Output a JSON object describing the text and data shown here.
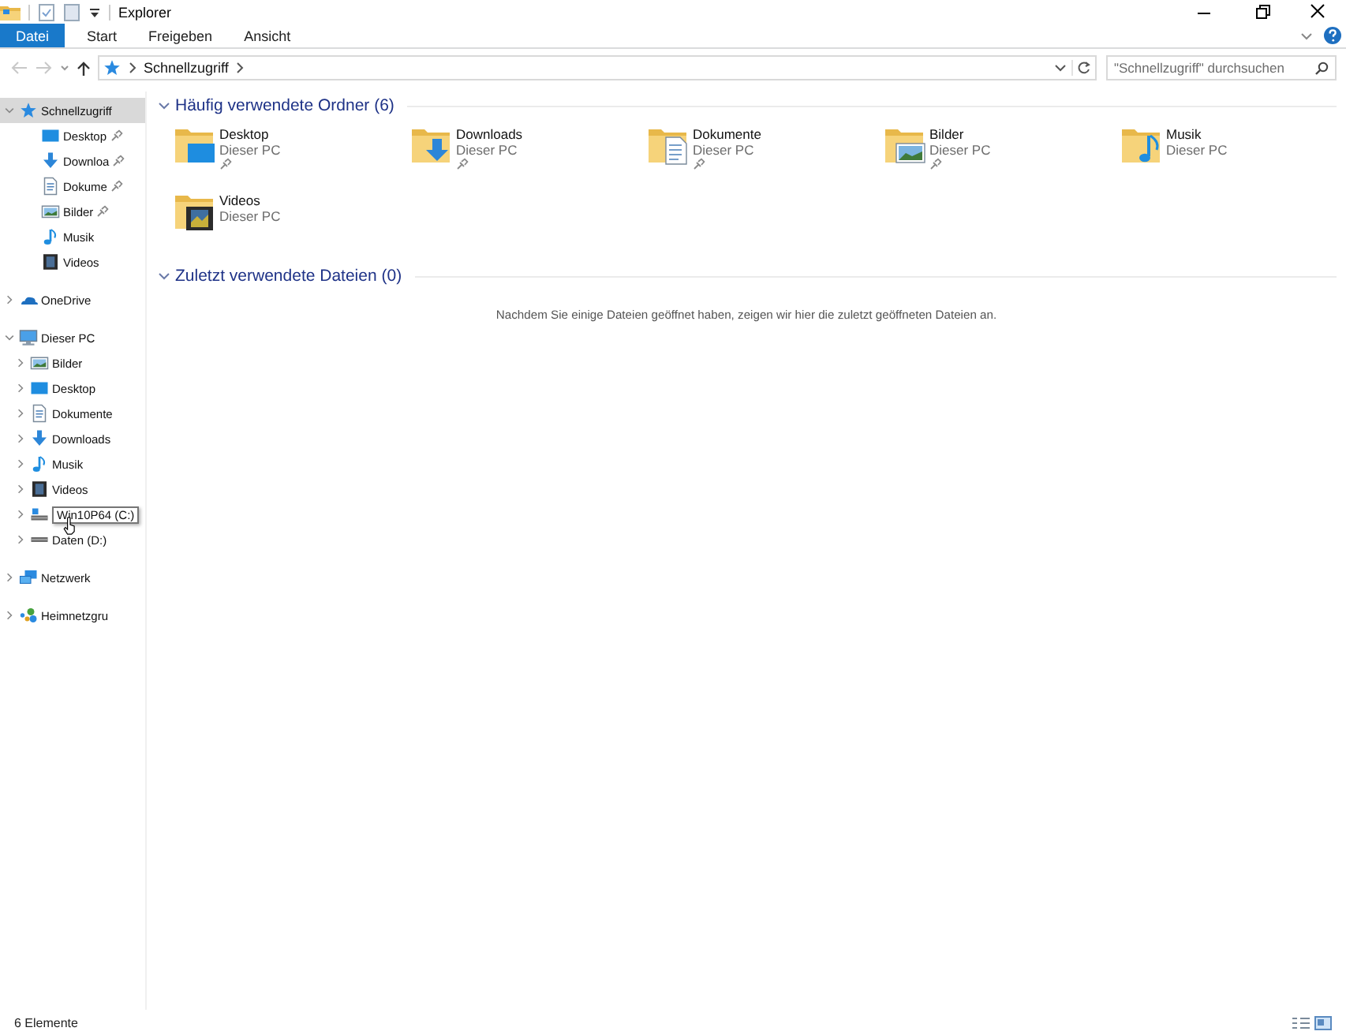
{
  "window": {
    "title": "Explorer"
  },
  "ribbon_tabs": [
    {
      "label": "Datei",
      "kind": "file"
    },
    {
      "label": "Start",
      "kind": "tab"
    },
    {
      "label": "Freigeben",
      "kind": "tab"
    },
    {
      "label": "Ansicht",
      "kind": "tab"
    }
  ],
  "navigation": {
    "back_disabled": true,
    "forward_disabled": true
  },
  "address_bar": {
    "breadcrumb": [
      "Schnellzugriff"
    ]
  },
  "search": {
    "placeholder": "\"Schnellzugriff\" durchsuchen"
  },
  "sidebar": {
    "items": [
      {
        "label": "Schnellzugriff",
        "kind": "star",
        "expanded": true,
        "selected": true,
        "hovered": false,
        "children": [
          {
            "label": "Desktop",
            "kind": "desktop",
            "pinned": true
          },
          {
            "label": "Downloa",
            "kind": "downloads",
            "pinned": true
          },
          {
            "label": "Dokume",
            "kind": "documents",
            "pinned": true
          },
          {
            "label": "Bilder",
            "kind": "pictures",
            "pinned": true
          },
          {
            "label": "Musik",
            "kind": "music",
            "pinned": false
          },
          {
            "label": "Videos",
            "kind": "videos",
            "pinned": false
          }
        ]
      },
      {
        "label": "OneDrive",
        "kind": "cloud",
        "expanded": false,
        "selected": false,
        "hovered": false
      },
      {
        "label": "Dieser PC",
        "kind": "pc",
        "expanded": true,
        "selected": false,
        "hovered": false,
        "children": [
          {
            "label": "Bilder",
            "kind": "pictures",
            "expanded": false,
            "hovered": false
          },
          {
            "label": "Desktop",
            "kind": "desktop",
            "expanded": false,
            "hovered": false
          },
          {
            "label": "Dokumente",
            "kind": "documents",
            "expanded": false,
            "hovered": false
          },
          {
            "label": "Downloads",
            "kind": "downloads",
            "expanded": false,
            "hovered": false
          },
          {
            "label": "Musik",
            "kind": "music",
            "expanded": false,
            "hovered": false
          },
          {
            "label": "Videos",
            "kind": "videos",
            "expanded": false,
            "hovered": false
          },
          {
            "label": "Win10P64 (C:)",
            "kind": "drive-os",
            "expanded": false,
            "hovered": true
          },
          {
            "label": "Daten (D:)",
            "kind": "drive",
            "expanded": false,
            "hovered": false
          }
        ]
      },
      {
        "label": "Netzwerk",
        "kind": "network",
        "expanded": false,
        "selected": false,
        "hovered": false
      },
      {
        "label": "Heimnetzgru",
        "kind": "homegroup",
        "expanded": false,
        "selected": false,
        "hovered": false
      }
    ]
  },
  "sections": [
    {
      "title": "Häufig verwendete Ordner (6)",
      "expanded": true,
      "items": [
        {
          "name": "Desktop",
          "location": "Dieser PC",
          "kind": "desktop",
          "pinned": true
        },
        {
          "name": "Downloads",
          "location": "Dieser PC",
          "kind": "downloads",
          "pinned": true
        },
        {
          "name": "Dokumente",
          "location": "Dieser PC",
          "kind": "documents",
          "pinned": true
        },
        {
          "name": "Bilder",
          "location": "Dieser PC",
          "kind": "pictures",
          "pinned": true
        },
        {
          "name": "Musik",
          "location": "Dieser PC",
          "kind": "music",
          "pinned": false
        },
        {
          "name": "Videos",
          "location": "Dieser PC",
          "kind": "videos",
          "pinned": false
        }
      ]
    },
    {
      "title": "Zuletzt verwendete Dateien (0)",
      "expanded": true,
      "empty_message": "Nachdem Sie einige Dateien geöffnet haben, zeigen wir hier die zuletzt geöffneten Dateien an."
    }
  ],
  "status_bar": {
    "item_count": "6 Elemente"
  }
}
